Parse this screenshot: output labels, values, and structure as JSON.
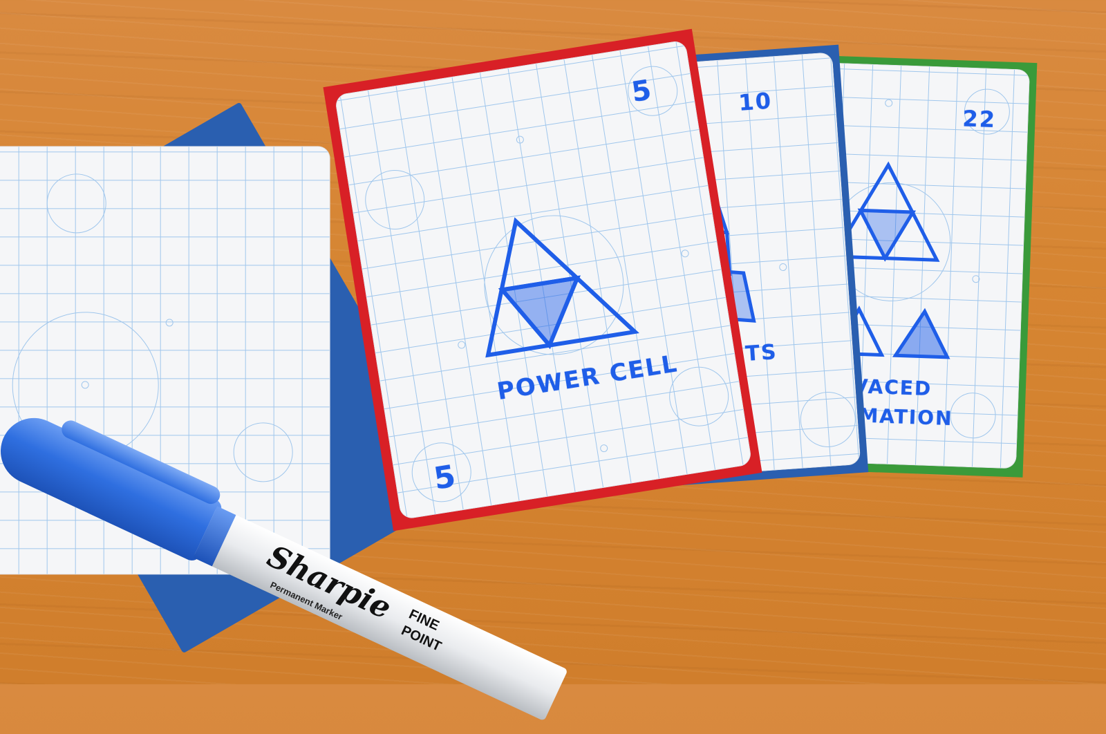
{
  "cards": [
    {
      "label": "POWER CELL",
      "value_top": "5",
      "value_bottom": "5",
      "border_color": "#d82026"
    },
    {
      "label": "ENTS",
      "value_top": "10",
      "border_color": "#2a5fb0"
    },
    {
      "label_line1": "VACED",
      "label_line2": "MATION",
      "value_top": "22",
      "border_color": "#3a9a3a"
    }
  ],
  "marker": {
    "brand": "Sharpie",
    "line1": "Permanent Marker",
    "size_line1": "FINE",
    "size_line2": "POINT",
    "color": "#2f6fe0"
  },
  "blank_card": {
    "border_color": "#2a5fb0"
  },
  "ink_color": "#1f5ee8",
  "table_color": "#d68532"
}
